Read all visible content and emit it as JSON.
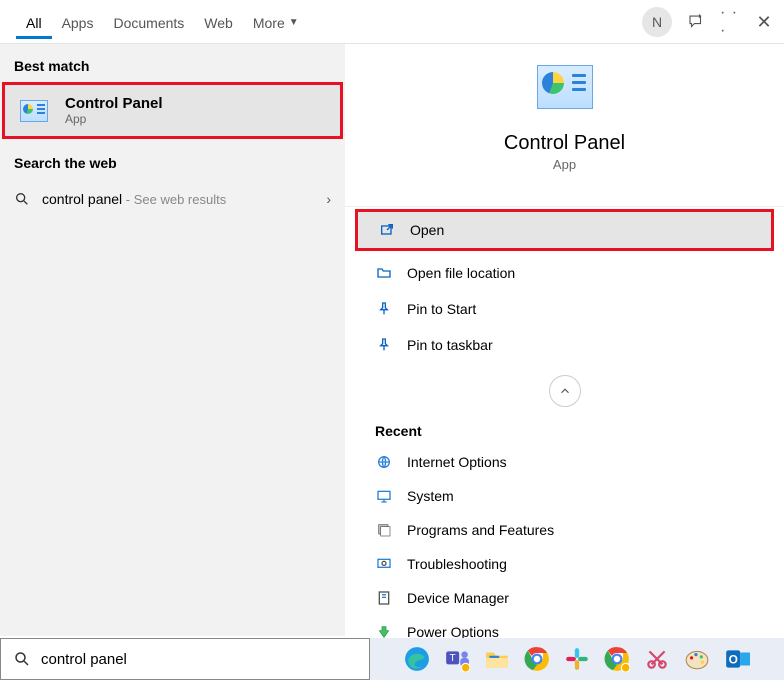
{
  "tabs": {
    "all": "All",
    "apps": "Apps",
    "documents": "Documents",
    "web": "Web",
    "more": "More"
  },
  "user_initial": "N",
  "left": {
    "best_match": "Best match",
    "result_title": "Control Panel",
    "result_sub": "App",
    "search_web": "Search the web",
    "web_query": "control panel",
    "web_hint": " - See web results"
  },
  "right": {
    "title": "Control Panel",
    "sub": "App",
    "actions": {
      "open": "Open",
      "open_file_location": "Open file location",
      "pin_start": "Pin to Start",
      "pin_taskbar": "Pin to taskbar"
    },
    "recent_h": "Recent",
    "recent": {
      "internet": "Internet Options",
      "system": "System",
      "programs": "Programs and Features",
      "troubleshooting": "Troubleshooting",
      "device_manager": "Device Manager",
      "power": "Power Options"
    }
  },
  "search_value": "control panel"
}
